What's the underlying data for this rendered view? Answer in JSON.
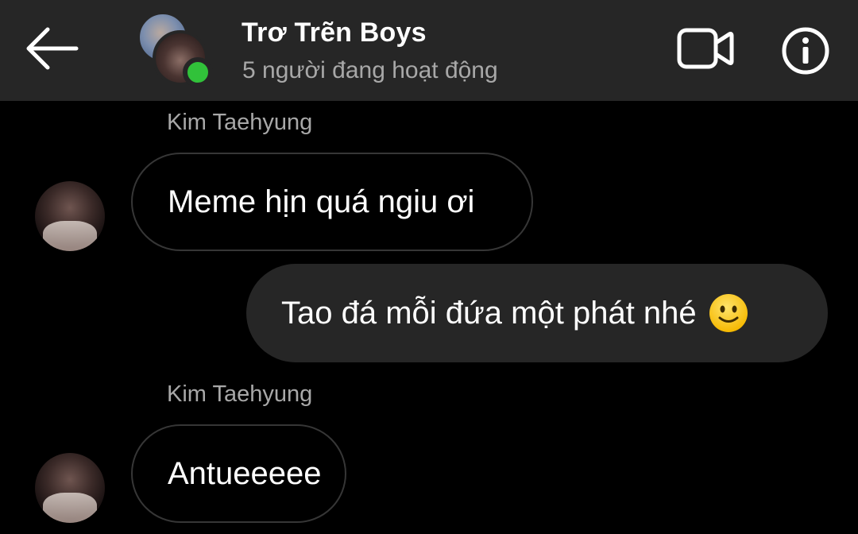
{
  "header": {
    "title": "Trơ Trẽn Boys",
    "status": "5 người đang hoạt động",
    "online_color": "#31c23a",
    "icons": {
      "back": "arrow-left-icon",
      "video": "video-camera-icon",
      "info": "info-icon"
    }
  },
  "messages": [
    {
      "direction": "incoming",
      "sender": "Kim Taehyung",
      "text": "Meme hịn quá ngiu ơi"
    },
    {
      "direction": "outgoing",
      "text": "Tao đá mỗi đứa một phát nhé",
      "emoji": "slightly-smiling-face"
    },
    {
      "direction": "incoming",
      "sender": "Kim Taehyung",
      "text": "Antueeeee"
    }
  ],
  "colors": {
    "background": "#000000",
    "header": "#262626",
    "outgoing_bubble": "#262626",
    "secondary_text": "#a8a8a8"
  }
}
